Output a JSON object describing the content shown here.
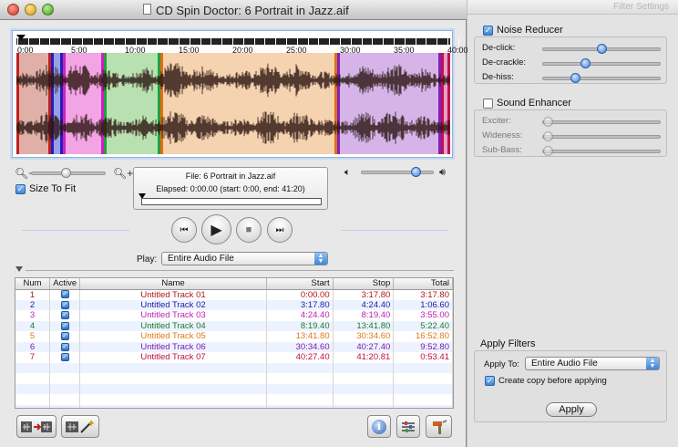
{
  "window": {
    "title": "CD Spin Doctor: 6 Portrait in Jazz.aif"
  },
  "ruler": {
    "labels": [
      "0:00",
      "5:00",
      "10:00",
      "15:00",
      "20:00",
      "25:00",
      "30:00",
      "35:00",
      "40:00"
    ]
  },
  "waveform": {
    "tracks": [
      {
        "num": "1",
        "color": "#e0b0a8",
        "edge": "#c02020"
      },
      {
        "num": "2",
        "color": "#9aa0e8",
        "edge": "#2020c0"
      },
      {
        "num": "3",
        "color": "#f2a4e4",
        "edge": "#d020c0"
      },
      {
        "num": "4",
        "color": "#b8e0b0",
        "edge": "#20a040"
      },
      {
        "num": "5",
        "color": "#f5d2b0",
        "edge": "#e07010"
      },
      {
        "num": "6",
        "color": "#d6b4e8",
        "edge": "#8020c0"
      },
      {
        "num": "7",
        "color": "#e8a0c8",
        "edge": "#c01050"
      }
    ]
  },
  "zoom": {
    "size_to_fit_label": "Size To Fit",
    "size_to_fit_checked": true,
    "zoom_level": 0.45
  },
  "info": {
    "file_line": "File: 6 Portrait in Jazz.aif",
    "elapsed_line": "Elapsed: 0:00.00 (start: 0:00, end: 41:20)",
    "progress": 0.0
  },
  "volume": {
    "level": 0.8
  },
  "transport": {
    "prev_glyph": "⏮",
    "play_glyph": "▶",
    "stop_glyph": "■",
    "next_glyph": "⏭"
  },
  "play": {
    "label": "Play:",
    "selected": "Entire Audio File"
  },
  "table": {
    "headers": [
      "Num",
      "Active",
      "Name",
      "Start",
      "Stop",
      "Total"
    ],
    "rows": [
      {
        "num": "1",
        "active": true,
        "name": "Untitled Track 01",
        "start": "0:00.00",
        "stop": "3:17.80",
        "total": "3:17.80",
        "color": "#b01818"
      },
      {
        "num": "2",
        "active": true,
        "name": "Untitled Track 02",
        "start": "3:17.80",
        "stop": "4:24.40",
        "total": "1:06.60",
        "color": "#1a1aa8"
      },
      {
        "num": "3",
        "active": true,
        "name": "Untitled Track 03",
        "start": "4:24.40",
        "stop": "8:19.40",
        "total": "3:55.00",
        "color": "#c21cb4"
      },
      {
        "num": "4",
        "active": true,
        "name": "Untitled Track 04",
        "start": "8:19.40",
        "stop": "13:41.80",
        "total": "5:22.40",
        "color": "#1c7a2c"
      },
      {
        "num": "5",
        "active": true,
        "name": "Untitled Track 05",
        "start": "13:41.80",
        "stop": "30:34.60",
        "total": "16:52.80",
        "color": "#e07a14"
      },
      {
        "num": "6",
        "active": true,
        "name": "Untitled Track 06",
        "start": "30:34.60",
        "stop": "40:27.40",
        "total": "9:52.80",
        "color": "#7a1ab4"
      },
      {
        "num": "7",
        "active": true,
        "name": "Untitled Track 07",
        "start": "40:27.40",
        "stop": "41:20.81",
        "total": "0:53.41",
        "color": "#c01038"
      }
    ]
  },
  "panel": {
    "title": "Filter Settings",
    "noise_reducer": {
      "label": "Noise Reducer",
      "checked": true,
      "params": [
        {
          "label": "De-click:",
          "value": 0.5
        },
        {
          "label": "De-crackle:",
          "value": 0.35
        },
        {
          "label": "De-hiss:",
          "value": 0.25
        }
      ]
    },
    "sound_enhancer": {
      "label": "Sound Enhancer",
      "checked": false,
      "params": [
        {
          "label": "Exciter:",
          "value": 0.0
        },
        {
          "label": "Wideness:",
          "value": 0.0
        },
        {
          "label": "Sub-Bass:",
          "value": 0.0
        }
      ]
    },
    "apply": {
      "section_title": "Apply Filters",
      "apply_to_label": "Apply To:",
      "apply_to_selected": "Entire Audio File",
      "copy_label": "Create copy before applying",
      "copy_checked": true,
      "button_label": "Apply"
    }
  }
}
